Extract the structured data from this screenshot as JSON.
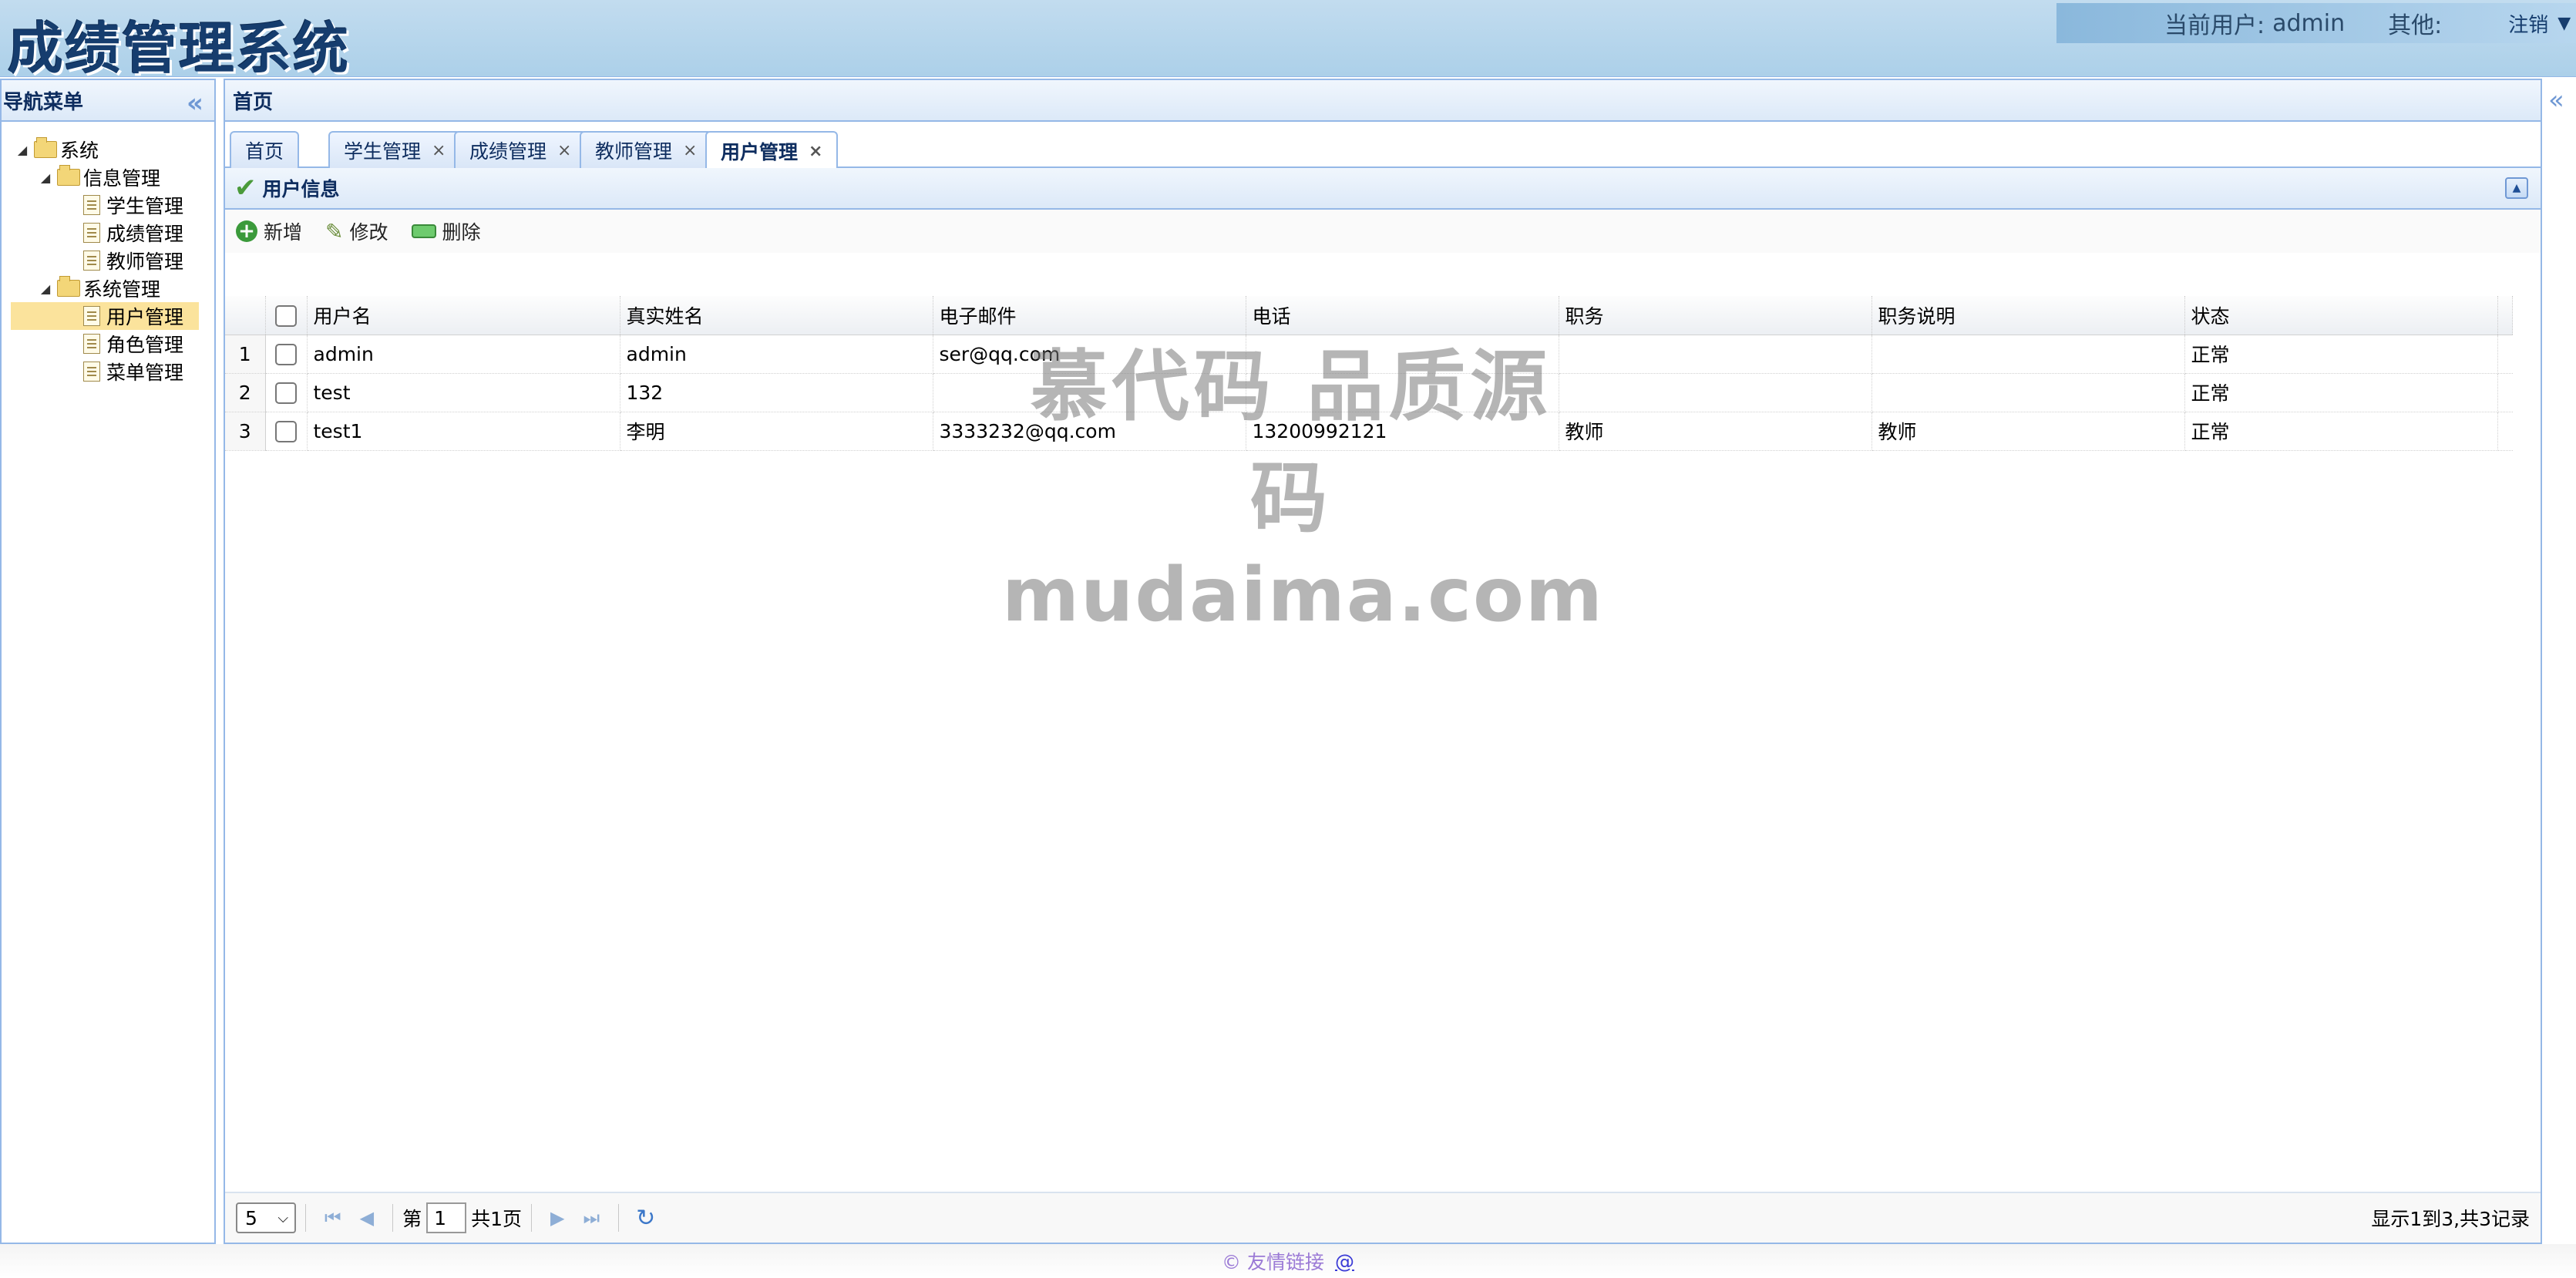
{
  "header": {
    "title": "成绩管理系统",
    "current_user_label": "当前用户:",
    "current_user": "admin",
    "other_label": "其他:",
    "logout": "注销"
  },
  "west": {
    "title": "导航菜单",
    "tree": [
      {
        "label": "系统",
        "level": 0,
        "type": "folder"
      },
      {
        "label": "信息管理",
        "level": 1,
        "type": "folder"
      },
      {
        "label": "学生管理",
        "level": 2,
        "type": "file"
      },
      {
        "label": "成绩管理",
        "level": 2,
        "type": "file"
      },
      {
        "label": "教师管理",
        "level": 2,
        "type": "file"
      },
      {
        "label": "系统管理",
        "level": 1,
        "type": "folder"
      },
      {
        "label": "用户管理",
        "level": 2,
        "type": "file",
        "selected": true
      },
      {
        "label": "角色管理",
        "level": 2,
        "type": "file"
      },
      {
        "label": "菜单管理",
        "level": 2,
        "type": "file"
      }
    ]
  },
  "center": {
    "title": "首页",
    "tabs": [
      {
        "label": "首页",
        "closable": false
      },
      {
        "label": "学生管理",
        "closable": true
      },
      {
        "label": "成绩管理",
        "closable": true
      },
      {
        "label": "教师管理",
        "closable": true
      },
      {
        "label": "用户管理",
        "closable": true,
        "active": true
      }
    ],
    "tab_close": "×",
    "panel_title": "用户信息",
    "toolbar": {
      "add": "新增",
      "edit": "修改",
      "delete": "删除"
    },
    "columns": [
      "用户名",
      "真实姓名",
      "电子邮件",
      "电话",
      "职务",
      "职务说明",
      "状态"
    ],
    "rows": [
      {
        "n": "1",
        "cells": [
          "admin",
          "admin",
          "ser@qq.com",
          "",
          "",
          "",
          "正常"
        ]
      },
      {
        "n": "2",
        "cells": [
          "test",
          "132",
          "",
          "",
          "",
          "",
          "正常"
        ]
      },
      {
        "n": "3",
        "cells": [
          "test1",
          "李明",
          "3333232@qq.com",
          "13200992121",
          "教师",
          "教师",
          "正常"
        ]
      }
    ],
    "pager": {
      "page_size": "5",
      "page_prefix": "第",
      "page": "1",
      "page_total": "共1页",
      "info": "显示1到3,共3记录"
    }
  },
  "footer": {
    "text": "© 友情链接",
    "link": "@"
  },
  "watermark": {
    "line1": "慕代码 品质源码",
    "line2": "mudaima.com"
  }
}
